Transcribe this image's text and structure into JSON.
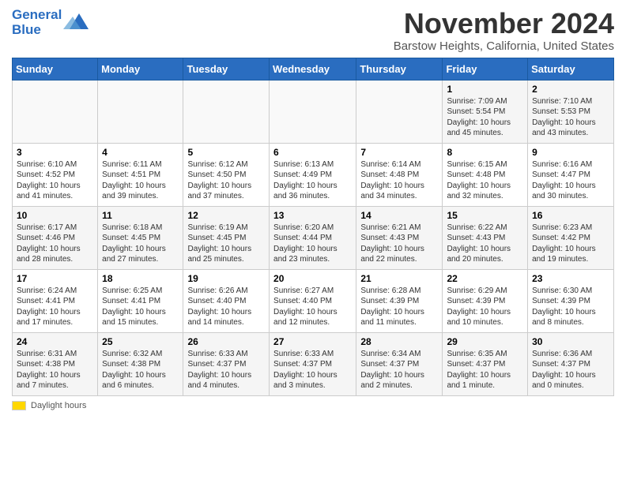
{
  "logo": {
    "text1": "General",
    "text2": "Blue"
  },
  "title": "November 2024",
  "subtitle": "Barstow Heights, California, United States",
  "days_of_week": [
    "Sunday",
    "Monday",
    "Tuesday",
    "Wednesday",
    "Thursday",
    "Friday",
    "Saturday"
  ],
  "footer": {
    "daylight_label": "Daylight hours"
  },
  "weeks": [
    [
      {
        "day": "",
        "info": ""
      },
      {
        "day": "",
        "info": ""
      },
      {
        "day": "",
        "info": ""
      },
      {
        "day": "",
        "info": ""
      },
      {
        "day": "",
        "info": ""
      },
      {
        "day": "1",
        "info": "Sunrise: 7:09 AM\nSunset: 5:54 PM\nDaylight: 10 hours and 45 minutes."
      },
      {
        "day": "2",
        "info": "Sunrise: 7:10 AM\nSunset: 5:53 PM\nDaylight: 10 hours and 43 minutes."
      }
    ],
    [
      {
        "day": "3",
        "info": "Sunrise: 6:10 AM\nSunset: 4:52 PM\nDaylight: 10 hours and 41 minutes."
      },
      {
        "day": "4",
        "info": "Sunrise: 6:11 AM\nSunset: 4:51 PM\nDaylight: 10 hours and 39 minutes."
      },
      {
        "day": "5",
        "info": "Sunrise: 6:12 AM\nSunset: 4:50 PM\nDaylight: 10 hours and 37 minutes."
      },
      {
        "day": "6",
        "info": "Sunrise: 6:13 AM\nSunset: 4:49 PM\nDaylight: 10 hours and 36 minutes."
      },
      {
        "day": "7",
        "info": "Sunrise: 6:14 AM\nSunset: 4:48 PM\nDaylight: 10 hours and 34 minutes."
      },
      {
        "day": "8",
        "info": "Sunrise: 6:15 AM\nSunset: 4:48 PM\nDaylight: 10 hours and 32 minutes."
      },
      {
        "day": "9",
        "info": "Sunrise: 6:16 AM\nSunset: 4:47 PM\nDaylight: 10 hours and 30 minutes."
      }
    ],
    [
      {
        "day": "10",
        "info": "Sunrise: 6:17 AM\nSunset: 4:46 PM\nDaylight: 10 hours and 28 minutes."
      },
      {
        "day": "11",
        "info": "Sunrise: 6:18 AM\nSunset: 4:45 PM\nDaylight: 10 hours and 27 minutes."
      },
      {
        "day": "12",
        "info": "Sunrise: 6:19 AM\nSunset: 4:45 PM\nDaylight: 10 hours and 25 minutes."
      },
      {
        "day": "13",
        "info": "Sunrise: 6:20 AM\nSunset: 4:44 PM\nDaylight: 10 hours and 23 minutes."
      },
      {
        "day": "14",
        "info": "Sunrise: 6:21 AM\nSunset: 4:43 PM\nDaylight: 10 hours and 22 minutes."
      },
      {
        "day": "15",
        "info": "Sunrise: 6:22 AM\nSunset: 4:43 PM\nDaylight: 10 hours and 20 minutes."
      },
      {
        "day": "16",
        "info": "Sunrise: 6:23 AM\nSunset: 4:42 PM\nDaylight: 10 hours and 19 minutes."
      }
    ],
    [
      {
        "day": "17",
        "info": "Sunrise: 6:24 AM\nSunset: 4:41 PM\nDaylight: 10 hours and 17 minutes."
      },
      {
        "day": "18",
        "info": "Sunrise: 6:25 AM\nSunset: 4:41 PM\nDaylight: 10 hours and 15 minutes."
      },
      {
        "day": "19",
        "info": "Sunrise: 6:26 AM\nSunset: 4:40 PM\nDaylight: 10 hours and 14 minutes."
      },
      {
        "day": "20",
        "info": "Sunrise: 6:27 AM\nSunset: 4:40 PM\nDaylight: 10 hours and 12 minutes."
      },
      {
        "day": "21",
        "info": "Sunrise: 6:28 AM\nSunset: 4:39 PM\nDaylight: 10 hours and 11 minutes."
      },
      {
        "day": "22",
        "info": "Sunrise: 6:29 AM\nSunset: 4:39 PM\nDaylight: 10 hours and 10 minutes."
      },
      {
        "day": "23",
        "info": "Sunrise: 6:30 AM\nSunset: 4:39 PM\nDaylight: 10 hours and 8 minutes."
      }
    ],
    [
      {
        "day": "24",
        "info": "Sunrise: 6:31 AM\nSunset: 4:38 PM\nDaylight: 10 hours and 7 minutes."
      },
      {
        "day": "25",
        "info": "Sunrise: 6:32 AM\nSunset: 4:38 PM\nDaylight: 10 hours and 6 minutes."
      },
      {
        "day": "26",
        "info": "Sunrise: 6:33 AM\nSunset: 4:37 PM\nDaylight: 10 hours and 4 minutes."
      },
      {
        "day": "27",
        "info": "Sunrise: 6:33 AM\nSunset: 4:37 PM\nDaylight: 10 hours and 3 minutes."
      },
      {
        "day": "28",
        "info": "Sunrise: 6:34 AM\nSunset: 4:37 PM\nDaylight: 10 hours and 2 minutes."
      },
      {
        "day": "29",
        "info": "Sunrise: 6:35 AM\nSunset: 4:37 PM\nDaylight: 10 hours and 1 minute."
      },
      {
        "day": "30",
        "info": "Sunrise: 6:36 AM\nSunset: 4:37 PM\nDaylight: 10 hours and 0 minutes."
      }
    ]
  ]
}
